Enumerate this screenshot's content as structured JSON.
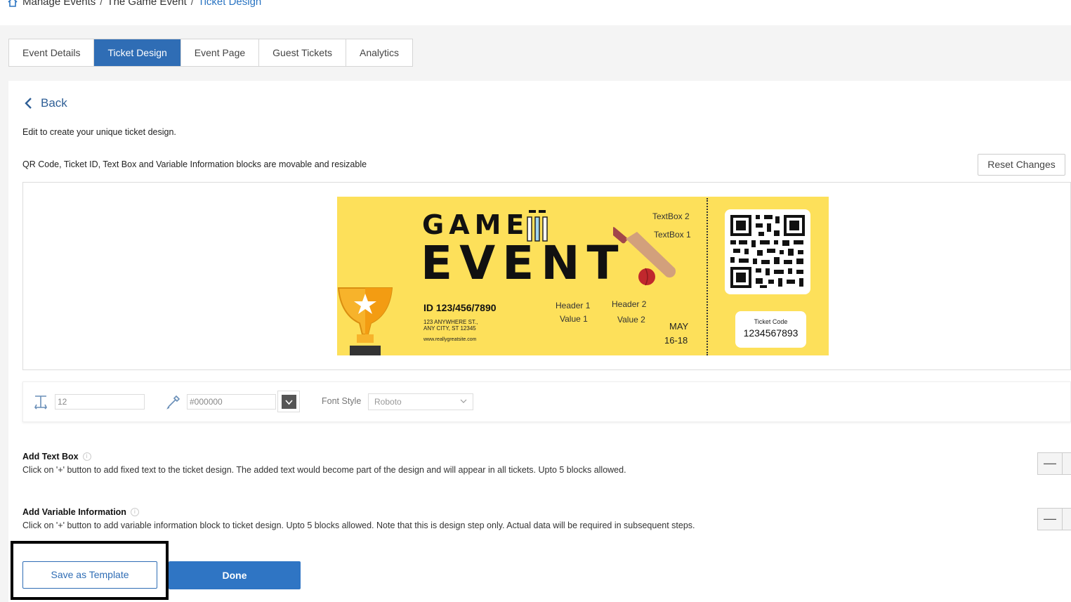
{
  "breadcrumb": {
    "items": [
      "Manage Events",
      "The Game Event",
      "Ticket Design"
    ],
    "separator": "/"
  },
  "tabs": [
    {
      "label": "Event Details"
    },
    {
      "label": "Ticket Design",
      "active": true
    },
    {
      "label": "Event Page"
    },
    {
      "label": "Guest Tickets"
    },
    {
      "label": "Analytics"
    }
  ],
  "main": {
    "back_label": "Back",
    "intro": "Edit to create your unique ticket design.",
    "movable_note": "QR Code, Ticket ID, Text Box and Variable Information blocks are movable and resizable",
    "reset_label": "Reset Changes"
  },
  "ticket": {
    "title_line1": "GAME",
    "title_line2": "EVENT",
    "id": "ID 123/456/7890",
    "address_line1": "123 ANYWHERE ST.,",
    "address_line2": "ANY CITY, ST 12345",
    "website": "www.reallygreatsite.com",
    "header1": "Header 1",
    "value1": "Value 1",
    "header2": "Header 2",
    "value2": "Value 2",
    "textbox2": "TextBox 2",
    "textbox1": "TextBox 1",
    "month": "MAY",
    "dates": "16-18",
    "code_label": "Ticket Code",
    "code_value": "1234567893",
    "bg_color": "#fde05a"
  },
  "toolbar": {
    "font_size_value": "12",
    "color_value": "#000000",
    "font_style_label": "Font Style",
    "font_style_value": "Roboto"
  },
  "sections": {
    "text_box_title": "Add Text Box",
    "text_box_desc": "Click on '+' button to add fixed text to the ticket design. The added text would become part of the design and will appear in all tickets. Upto 5 blocks allowed.",
    "variable_title": "Add Variable Information",
    "variable_desc": "Click on '+' button to add variable information block to ticket design. Upto 5 blocks allowed. Note that this is design step only. Actual data will be required in subsequent steps.",
    "minus_symbol": "—"
  },
  "actions": {
    "save_template_label": "Save as Template",
    "done_label": "Done"
  },
  "colors": {
    "primary": "#2f6db5",
    "accent_blue": "#2a74c2"
  }
}
